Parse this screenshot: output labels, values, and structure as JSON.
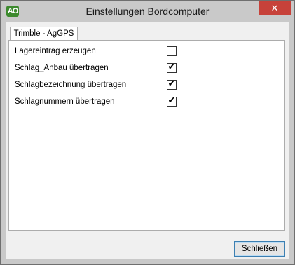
{
  "window": {
    "title": "Einstellungen Bordcomputer",
    "icon_text": "AO",
    "close_glyph": "✕"
  },
  "tabs": [
    {
      "label": "Trimble - AgGPS",
      "selected": true
    }
  ],
  "options": [
    {
      "label": "Lagereintrag erzeugen",
      "checked": false
    },
    {
      "label": "Schlag_Anbau übertragen",
      "checked": true
    },
    {
      "label": "Schlagbezeichnung übertragen",
      "checked": true
    },
    {
      "label": "Schlagnummern übertragen",
      "checked": true
    }
  ],
  "footer": {
    "close_label": "Schließen"
  },
  "colors": {
    "accent": "#3c7fb1",
    "close_button": "#c7423a",
    "app_icon": "#3d8a2e"
  }
}
